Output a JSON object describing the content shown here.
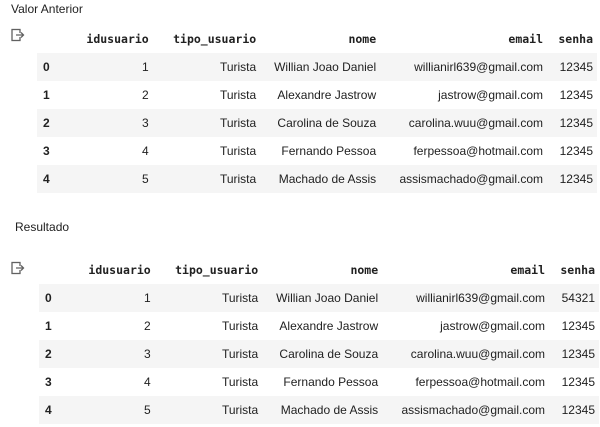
{
  "before": {
    "label": "Valor Anterior",
    "columns": [
      "idusuario",
      "tipo_usuario",
      "nome",
      "email",
      "senha"
    ],
    "rows": [
      {
        "index": "0",
        "idusuario": "1",
        "tipo_usuario": "Turista",
        "nome": "Willian Joao Daniel",
        "email": "willianirl639@gmail.com",
        "senha": "12345"
      },
      {
        "index": "1",
        "idusuario": "2",
        "tipo_usuario": "Turista",
        "nome": "Alexandre Jastrow",
        "email": "jastrow@gmail.com",
        "senha": "12345"
      },
      {
        "index": "2",
        "idusuario": "3",
        "tipo_usuario": "Turista",
        "nome": "Carolina de Souza",
        "email": "carolina.wuu@gmail.com",
        "senha": "12345"
      },
      {
        "index": "3",
        "idusuario": "4",
        "tipo_usuario": "Turista",
        "nome": "Fernando Pessoa",
        "email": "ferpessoa@hotmail.com",
        "senha": "12345"
      },
      {
        "index": "4",
        "idusuario": "5",
        "tipo_usuario": "Turista",
        "nome": "Machado de Assis",
        "email": "assismachado@gmail.com",
        "senha": "12345"
      }
    ]
  },
  "after": {
    "label": "Resultado",
    "columns": [
      "idusuario",
      "tipo_usuario",
      "nome",
      "email",
      "senha"
    ],
    "rows": [
      {
        "index": "0",
        "idusuario": "1",
        "tipo_usuario": "Turista",
        "nome": "Willian Joao Daniel",
        "email": "willianirl639@gmail.com",
        "senha": "54321"
      },
      {
        "index": "1",
        "idusuario": "2",
        "tipo_usuario": "Turista",
        "nome": "Alexandre Jastrow",
        "email": "jastrow@gmail.com",
        "senha": "12345"
      },
      {
        "index": "2",
        "idusuario": "3",
        "tipo_usuario": "Turista",
        "nome": "Carolina de Souza",
        "email": "carolina.wuu@gmail.com",
        "senha": "12345"
      },
      {
        "index": "3",
        "idusuario": "4",
        "tipo_usuario": "Turista",
        "nome": "Fernando Pessoa",
        "email": "ferpessoa@hotmail.com",
        "senha": "12345"
      },
      {
        "index": "4",
        "idusuario": "5",
        "tipo_usuario": "Turista",
        "nome": "Machado de Assis",
        "email": "assismachado@gmail.com",
        "senha": "12345"
      }
    ]
  },
  "icons": {
    "output_icon": "output-arrow-icon"
  },
  "colors": {
    "stripe": "#f5f5f5",
    "text": "#212121",
    "icon": "#616161"
  }
}
